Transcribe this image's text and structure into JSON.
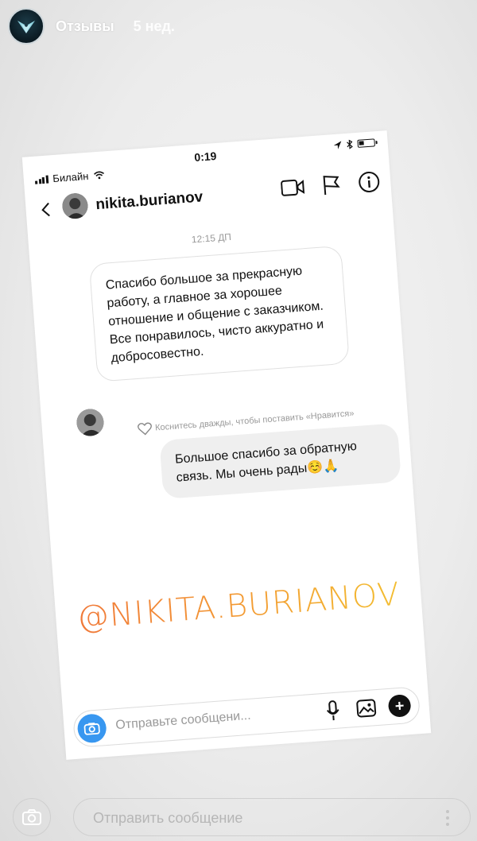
{
  "story": {
    "title": "Отзывы",
    "time_ago": "5 нед.",
    "avatar_icon": "logo-wings-icon",
    "reply_placeholder": "Отправить сообщение"
  },
  "screenshot": {
    "status": {
      "carrier": "Билайн",
      "time": "0:19"
    },
    "header": {
      "username": "nikita.burianov",
      "icons": [
        "video-call-icon",
        "flag-icon",
        "info-icon"
      ]
    },
    "thread": {
      "timestamp": "12:15 ДП",
      "incoming_message": "Спасибо большое за прекрасную работу, а главное за хорошее отношение и общение с заказчиком. Все понравилось, чисто аккуратно и добросовестно.",
      "like_hint": "Коснитесь дважды, чтобы поставить «Нравится»",
      "outgoing_message": "Большое спасибо за обратную связь. Мы очень рады☺️🙏"
    },
    "watermark": "@NIKITA.BURIANOV",
    "composer": {
      "placeholder": "Отправьте сообщени..."
    }
  },
  "colors": {
    "accent_blue": "#3897f0",
    "watermark_start": "#f0753a",
    "watermark_end": "#f3c22f"
  }
}
